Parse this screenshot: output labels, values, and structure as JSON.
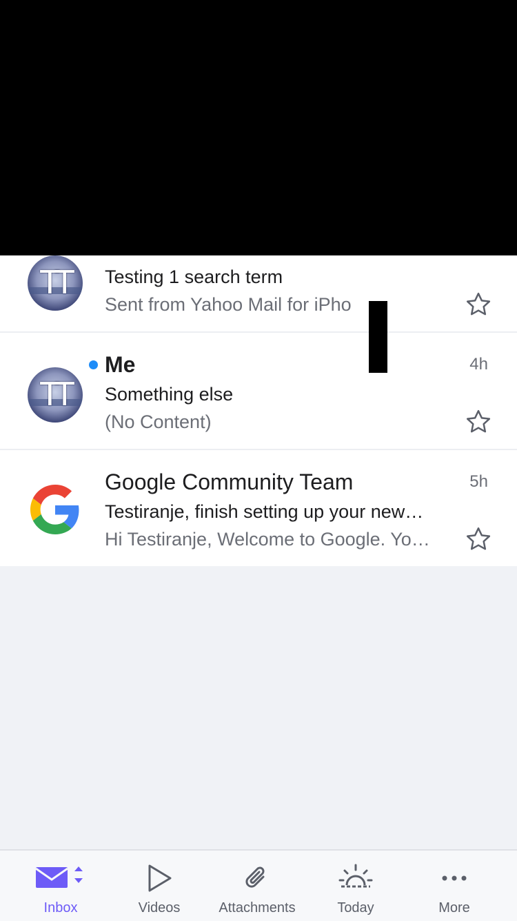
{
  "messages": [
    {
      "subject": "Testing 1 search term",
      "snippet": "Sent from Yahoo Mail for iPho",
      "avatar": "TT",
      "starred": false
    },
    {
      "sender": "Me",
      "time": "4h",
      "subject": "Something else",
      "snippet": "(No Content)",
      "avatar": "TT",
      "unread": true,
      "starred": false
    },
    {
      "sender": "Google Community Team",
      "time": "5h",
      "subject": "Testiranje, finish setting up your new…",
      "snippet": "Hi Testiranje, Welcome to Google. Yo…",
      "avatar_icon": "google-logo-icon",
      "starred": false
    }
  ],
  "tabbar": {
    "items": [
      {
        "label": "Inbox",
        "icon": "mail-icon",
        "active": true
      },
      {
        "label": "Videos",
        "icon": "play-icon"
      },
      {
        "label": "Attachments",
        "icon": "paperclip-icon"
      },
      {
        "label": "Today",
        "icon": "sunrise-icon"
      },
      {
        "label": "More",
        "icon": "more-dots-icon"
      }
    ]
  },
  "colors": {
    "accent": "#6d5bf7",
    "unread_dot": "#1d8cf8",
    "background": "#f0f2f6"
  }
}
